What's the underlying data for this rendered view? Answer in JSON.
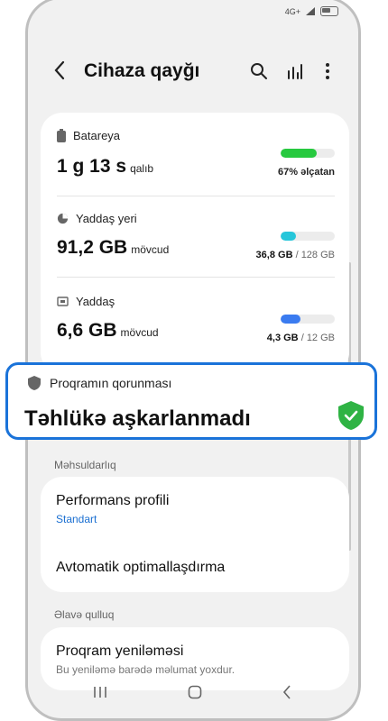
{
  "status": {
    "network": "4G+"
  },
  "appbar": {
    "title": "Cihaza qayğı"
  },
  "battery": {
    "label": "Batareya",
    "value": "1 g 13 s",
    "unit": "qalıb",
    "right": "67% əlçatan",
    "level": 0.67,
    "color": "#27c93f"
  },
  "storage": {
    "label": "Yaddaş yeri",
    "value": "91,2 GB",
    "unit": "mövcud",
    "used": "36,8 GB",
    "total": "/ 128 GB",
    "level": 0.29,
    "color": "#26c6da"
  },
  "memory": {
    "label": "Yaddaş",
    "value": "6,6 GB",
    "unit": "mövcud",
    "used": "4,3 GB",
    "total": "/ 12 GB",
    "level": 0.36,
    "color": "#3a7bf0"
  },
  "protection": {
    "label": "Proqramın qorunması",
    "status": "Təhlükə aşkarlanmadı",
    "accent": "#1a73d9",
    "shield_color": "#2fb344"
  },
  "performance": {
    "section": "Məhsuldarlıq",
    "profile_title": "Performans profili",
    "profile_value": "Standart",
    "auto_opt": "Avtomatik optimallaşdırma"
  },
  "extra": {
    "section": "Əlavə qulluq",
    "update_title": "Proqram yeniləməsi",
    "update_sub": "Bu yeniləmə barədə məlumat yoxdur."
  }
}
